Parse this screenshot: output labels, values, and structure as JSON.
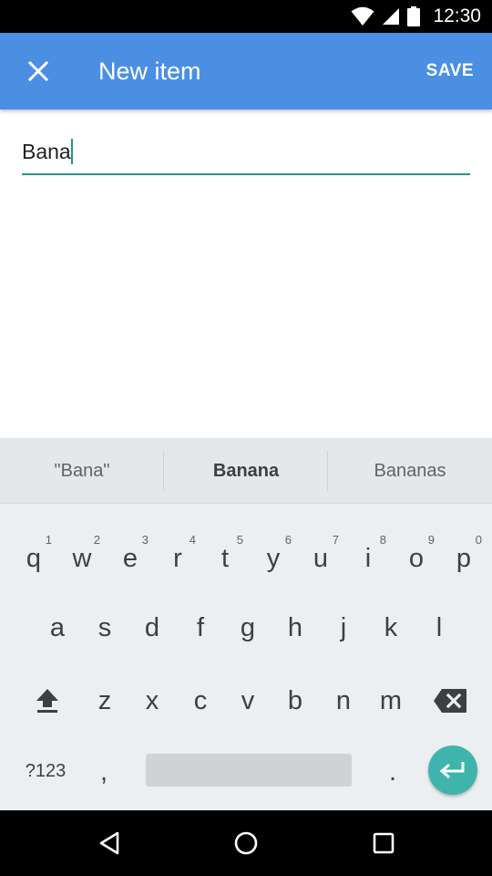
{
  "status_bar": {
    "time": "12:30",
    "icons": [
      "wifi-icon",
      "signal-icon",
      "battery-icon"
    ]
  },
  "app_bar": {
    "title": "New item",
    "close_icon": "close-icon",
    "save_label": "SAVE",
    "color": "#4a8fe2"
  },
  "form": {
    "item_name_value": "Bana",
    "accent_color": "#1e9a8e"
  },
  "keyboard": {
    "suggestions": [
      "\"Bana\"",
      "Banana",
      "Bananas"
    ],
    "row1": [
      {
        "key": "q",
        "hint": "1"
      },
      {
        "key": "w",
        "hint": "2"
      },
      {
        "key": "e",
        "hint": "3"
      },
      {
        "key": "r",
        "hint": "4"
      },
      {
        "key": "t",
        "hint": "5"
      },
      {
        "key": "y",
        "hint": "6"
      },
      {
        "key": "u",
        "hint": "7"
      },
      {
        "key": "i",
        "hint": "8"
      },
      {
        "key": "o",
        "hint": "9"
      },
      {
        "key": "p",
        "hint": "0"
      }
    ],
    "row2": [
      "a",
      "s",
      "d",
      "f",
      "g",
      "h",
      "j",
      "k",
      "l"
    ],
    "row3": [
      "z",
      "x",
      "c",
      "v",
      "b",
      "n",
      "m"
    ],
    "symbols_label": "?123",
    "comma": ",",
    "period": ".",
    "shift_icon": "shift-icon",
    "backspace_icon": "backspace-icon",
    "enter_icon": "enter-icon",
    "enter_color": "#3eb4ac"
  },
  "nav_bar": {
    "icons": [
      "back-icon",
      "home-icon",
      "recents-icon"
    ]
  }
}
